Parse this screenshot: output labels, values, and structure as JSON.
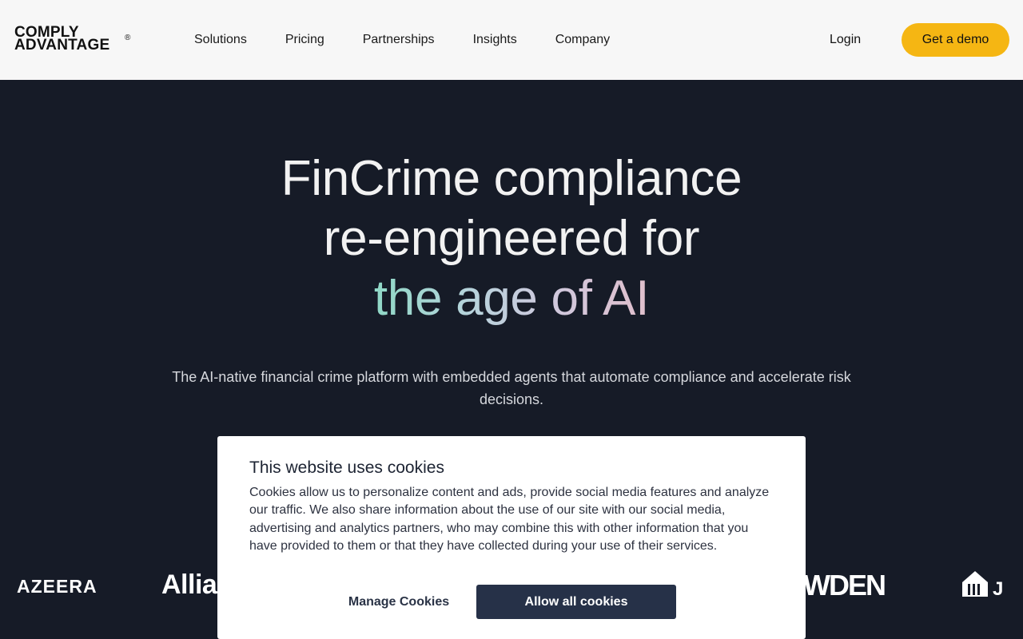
{
  "header": {
    "logo": {
      "line1": "COMPLY",
      "line2": "ADVANTAGE",
      "mark": "®"
    },
    "nav": [
      "Solutions",
      "Pricing",
      "Partnerships",
      "Insights",
      "Company"
    ],
    "login": "Login",
    "demo_button": "Get a demo"
  },
  "hero": {
    "title_line1": "FinCrime compliance",
    "title_line2": "re-engineered for",
    "title_line3": "the age of AI",
    "subtitle": "The AI-native financial crime platform with embedded agents that automate compliance and accelerate risk decisions."
  },
  "partners": {
    "azeera": "AZEERA",
    "allianz": "Allia",
    "wden": "WDEN",
    "je_icon": "just-eat-icon"
  },
  "cookie_banner": {
    "title": "This website uses cookies",
    "body": "Cookies allow us to personalize content and ads, provide social media features and analyze our traffic. We also share information about the use of our site with our social media, advertising and analytics partners, who may combine this with other information that you have provided to them or that they have collected during your use of their services.",
    "manage_label": "Manage Cookies",
    "allow_label": "Allow all cookies"
  },
  "colors": {
    "background": "#161b27",
    "header_bg": "#f7f7f7",
    "accent": "#f5b613",
    "dialog_button": "#263148"
  }
}
